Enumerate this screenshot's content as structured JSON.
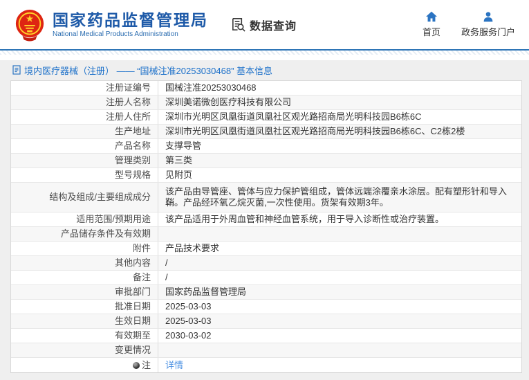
{
  "header": {
    "logo": {
      "title": "国家药品监督管理局",
      "subtitle": "National Medical Products Administration",
      "emblem_icon": "national-emblem-icon"
    },
    "search_label": "数据查询",
    "search_icon": "document-magnifier-icon",
    "nav": [
      {
        "label": "首页",
        "icon": "home-icon"
      },
      {
        "label": "政务服务门户",
        "icon": "user-icon"
      }
    ]
  },
  "breadcrumb": {
    "icon": "document-icon",
    "text": "境内医疗器械（注册） —— “国械注准20253030468” 基本信息"
  },
  "table": {
    "rows": [
      {
        "label": "注册证编号",
        "value": "国械注准20253030468"
      },
      {
        "label": "注册人名称",
        "value": "深圳美诺微创医疗科技有限公司"
      },
      {
        "label": "注册人住所",
        "value": "深圳市光明区凤凰街道凤凰社区观光路招商局光明科技园B6栋6C"
      },
      {
        "label": "生产地址",
        "value": "深圳市光明区凤凰街道凤凰社区观光路招商局光明科技园B6栋6C、C2栋2楼"
      },
      {
        "label": "产品名称",
        "value": "支撑导管"
      },
      {
        "label": "管理类别",
        "value": "第三类"
      },
      {
        "label": "型号规格",
        "value": "见附页"
      },
      {
        "label": "结构及组成/主要组成成分",
        "value": "该产品由导管座、管体与应力保护管组成，管体远端涂覆亲水涂层。配有塑形针和导入鞘。产品经环氧乙烷灭菌,一次性使用。货架有效期3年。"
      },
      {
        "label": "适用范围/预期用途",
        "value": "该产品适用于外周血管和神经血管系统，用于导入诊断性或治疗装置。"
      },
      {
        "label": "产品储存条件及有效期",
        "value": ""
      },
      {
        "label": "附件",
        "value": "产品技术要求"
      },
      {
        "label": "其他内容",
        "value": "/"
      },
      {
        "label": "备注",
        "value": "/"
      },
      {
        "label": "审批部门",
        "value": "国家药品监督管理局"
      },
      {
        "label": "批准日期",
        "value": "2025-03-03"
      },
      {
        "label": "生效日期",
        "value": "2025-03-03"
      },
      {
        "label": "有效期至",
        "value": "2030-03-02"
      },
      {
        "label": "变更情况",
        "value": ""
      },
      {
        "label": "注",
        "value": "详情",
        "icon": "note-dot-icon",
        "value_is_link": true
      }
    ]
  },
  "colors": {
    "brand_blue": "#1e5aa8",
    "divider_blue": "#2e75b6",
    "link_blue": "#4a90e2",
    "emblem_red": "#de2512",
    "emblem_gold": "#ffd02a",
    "breadcrumb_blue": "#1a6fc9",
    "content_bg": "#efefef"
  }
}
